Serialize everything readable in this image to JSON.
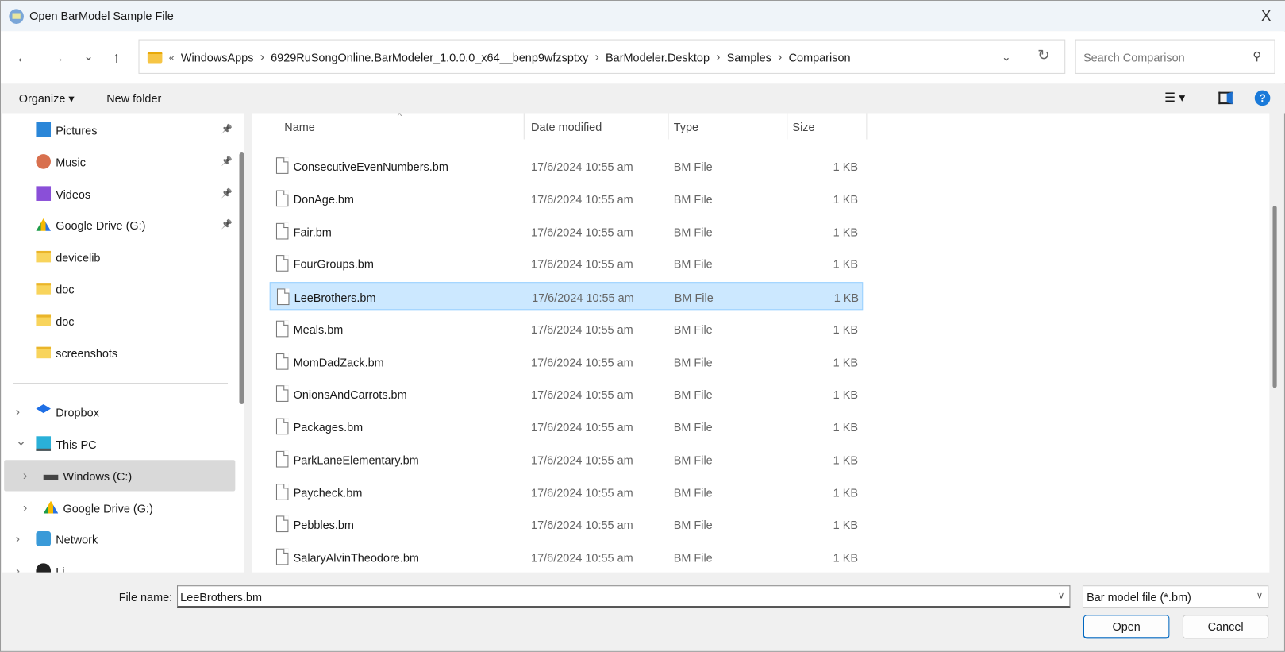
{
  "window": {
    "title": "Open BarModel Sample File",
    "close_label": "X"
  },
  "nav": {
    "back": "←",
    "forward": "→",
    "recent": "⌄",
    "up": "↑",
    "breadcrumb": {
      "overflow": "«",
      "items": [
        "WindowsApps",
        "6929RuSongOnline.BarModeler_1.0.0.0_x64__benp9wfzsptxy",
        "BarModeler.Desktop",
        "Samples",
        "Comparison"
      ]
    },
    "refresh": "↻",
    "dropdown": "⌄"
  },
  "search": {
    "placeholder": "Search Comparison"
  },
  "toolbar": {
    "organize": "Organize ▾",
    "new_folder": "New folder",
    "view": "☰ ▾",
    "help": "?"
  },
  "sidebar": {
    "quick": [
      {
        "label": "Pictures",
        "icon": "pictures-icon",
        "pinned": true
      },
      {
        "label": "Music",
        "icon": "music-icon",
        "pinned": true
      },
      {
        "label": "Videos",
        "icon": "videos-icon",
        "pinned": true
      },
      {
        "label": "Google Drive (G:)",
        "icon": "google-drive-icon",
        "pinned": true
      },
      {
        "label": "devicelib",
        "icon": "folder-icon"
      },
      {
        "label": "doc",
        "icon": "folder-icon"
      },
      {
        "label": "doc",
        "icon": "folder-icon"
      },
      {
        "label": "screenshots",
        "icon": "folder-icon"
      }
    ],
    "tree": [
      {
        "label": "Dropbox",
        "icon": "dropbox-icon",
        "expanded": false
      },
      {
        "label": "This PC",
        "icon": "pc-icon",
        "expanded": true
      },
      {
        "label": "Windows (C:)",
        "icon": "drive-icon",
        "selected": true
      },
      {
        "label": "Google Drive (G:)",
        "icon": "google-drive-icon"
      },
      {
        "label": "Network",
        "icon": "network-icon"
      },
      {
        "label": "Li...",
        "icon": "linux-icon"
      }
    ]
  },
  "columns": {
    "name": "Name",
    "date": "Date modified",
    "type": "Type",
    "size": "Size"
  },
  "files": [
    {
      "name": "ConsecutiveEvenNumbers.bm",
      "date": "17/6/2024 10:55 am",
      "type": "BM File",
      "size": "1 KB"
    },
    {
      "name": "DonAge.bm",
      "date": "17/6/2024 10:55 am",
      "type": "BM File",
      "size": "1 KB"
    },
    {
      "name": "Fair.bm",
      "date": "17/6/2024 10:55 am",
      "type": "BM File",
      "size": "1 KB"
    },
    {
      "name": "FourGroups.bm",
      "date": "17/6/2024 10:55 am",
      "type": "BM File",
      "size": "1 KB"
    },
    {
      "name": "LeeBrothers.bm",
      "date": "17/6/2024 10:55 am",
      "type": "BM File",
      "size": "1 KB"
    },
    {
      "name": "Meals.bm",
      "date": "17/6/2024 10:55 am",
      "type": "BM File",
      "size": "1 KB"
    },
    {
      "name": "MomDadZack.bm",
      "date": "17/6/2024 10:55 am",
      "type": "BM File",
      "size": "1 KB"
    },
    {
      "name": "OnionsAndCarrots.bm",
      "date": "17/6/2024 10:55 am",
      "type": "BM File",
      "size": "1 KB"
    },
    {
      "name": "Packages.bm",
      "date": "17/6/2024 10:55 am",
      "type": "BM File",
      "size": "1 KB"
    },
    {
      "name": "ParkLaneElementary.bm",
      "date": "17/6/2024 10:55 am",
      "type": "BM File",
      "size": "1 KB"
    },
    {
      "name": "Paycheck.bm",
      "date": "17/6/2024 10:55 am",
      "type": "BM File",
      "size": "1 KB"
    },
    {
      "name": "Pebbles.bm",
      "date": "17/6/2024 10:55 am",
      "type": "BM File",
      "size": "1 KB"
    },
    {
      "name": "SalaryAlvinTheodore.bm",
      "date": "17/6/2024 10:55 am",
      "type": "BM File",
      "size": "1 KB"
    }
  ],
  "selected_file": "LeeBrothers.bm",
  "footer": {
    "file_name_label": "File name:",
    "file_name_value": "LeeBrothers.bm",
    "filter": "Bar model file (*.bm)",
    "open": "Open",
    "cancel": "Cancel"
  },
  "colors": {
    "accent": "#0067c0",
    "selection": "#cce8ff"
  }
}
